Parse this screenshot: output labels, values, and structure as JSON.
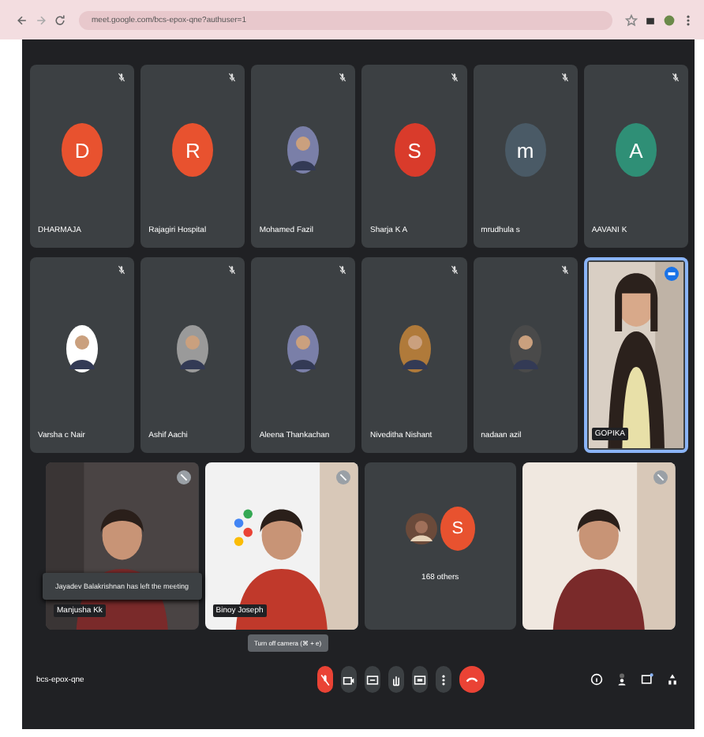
{
  "browser": {
    "url": "meet.google.com/bcs-epox-qne?authuser=1"
  },
  "top_tiles": [
    {
      "name": "DHARMAJA",
      "kind": "initial",
      "initial": "D",
      "color": "#e8522f",
      "speaking": false
    },
    {
      "name": "Rajagiri Hospital",
      "kind": "initial",
      "initial": "R",
      "color": "#e8522f",
      "speaking": false
    },
    {
      "name": "Mohamed Fazil",
      "kind": "avatar",
      "speaking": false
    },
    {
      "name": "Sharja K A",
      "kind": "initial",
      "initial": "S",
      "color": "#d93b2b",
      "speaking": false
    },
    {
      "name": "mrudhula s",
      "kind": "initial",
      "initial": "m",
      "color": "#4a5a66",
      "speaking": false
    },
    {
      "name": "AAVANI K",
      "kind": "initial",
      "initial": "A",
      "color": "#2f8f76",
      "speaking": false
    },
    {
      "name": "Varsha c Nair",
      "kind": "avatar",
      "speaking": false
    },
    {
      "name": "Ashif Aachi",
      "kind": "avatar",
      "speaking": false
    },
    {
      "name": "Aleena Thankachan",
      "kind": "avatar",
      "speaking": false
    },
    {
      "name": "Niveditha Nishant",
      "kind": "avatar",
      "speaking": false
    },
    {
      "name": "nadaan azil",
      "kind": "avatar",
      "speaking": false
    },
    {
      "name": "GOPIKA",
      "kind": "video",
      "speaking": true
    }
  ],
  "bottom_tiles": [
    {
      "name": "Manjusha Kk",
      "kind": "video"
    },
    {
      "name": "Binoy Joseph",
      "kind": "video"
    },
    {
      "name": "168 others",
      "kind": "others",
      "initial": "S",
      "color": "#e8522f"
    },
    {
      "kind": "video"
    }
  ],
  "toast": "Jayadev Balakrishnan has left the meeting",
  "tooltip": "Turn off camera (⌘ + e)",
  "meeting_code": "bcs-epox-qne",
  "controls": [
    {
      "kind": "mic",
      "muted": true
    },
    {
      "kind": "camera"
    },
    {
      "kind": "captions"
    },
    {
      "kind": "hand"
    },
    {
      "kind": "present"
    },
    {
      "kind": "more"
    },
    {
      "kind": "leave"
    }
  ]
}
